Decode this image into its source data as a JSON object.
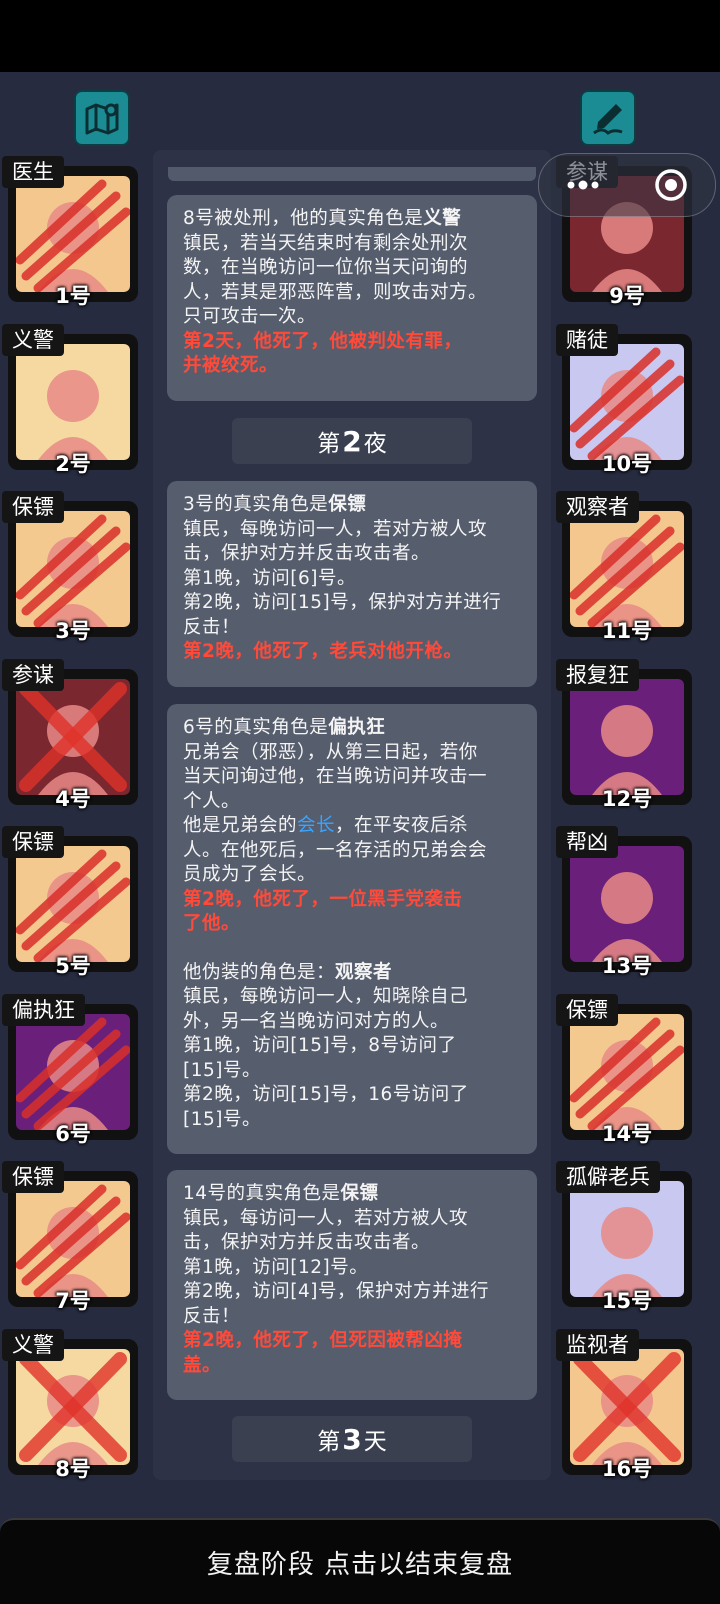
{
  "header": {
    "map_icon": "map-icon",
    "notes_icon": "pen-notepad-icon"
  },
  "left_players": [
    {
      "role": "医生",
      "number": "1号",
      "art_bg": "#f4c78e",
      "status": "claw"
    },
    {
      "role": "义警",
      "number": "2号",
      "art_bg": "#f6d9a0",
      "status": "alive"
    },
    {
      "role": "保镖",
      "number": "3号",
      "art_bg": "#f3c98f",
      "status": "claw"
    },
    {
      "role": "参谋",
      "number": "4号",
      "art_bg": "#7a2730",
      "status": "x"
    },
    {
      "role": "保镖",
      "number": "5号",
      "art_bg": "#f3c98f",
      "status": "claw"
    },
    {
      "role": "偏执狂",
      "number": "6号",
      "art_bg": "#6a1f7a",
      "status": "claw"
    },
    {
      "role": "保镖",
      "number": "7号",
      "art_bg": "#f3c98f",
      "status": "claw"
    },
    {
      "role": "义警",
      "number": "8号",
      "art_bg": "#f6d9a0",
      "status": "x"
    }
  ],
  "right_players": [
    {
      "role": "参谋",
      "number": "9号",
      "art_bg": "#7a2730",
      "status": "alive"
    },
    {
      "role": "赌徒",
      "number": "10号",
      "art_bg": "#c8c8f0",
      "status": "claw"
    },
    {
      "role": "观察者",
      "number": "11号",
      "art_bg": "#f4c78e",
      "status": "claw"
    },
    {
      "role": "报复狂",
      "number": "12号",
      "art_bg": "#6a1f7a",
      "status": "alive"
    },
    {
      "role": "帮凶",
      "number": "13号",
      "art_bg": "#6a1f7a",
      "status": "alive"
    },
    {
      "role": "保镖",
      "number": "14号",
      "art_bg": "#f3c98f",
      "status": "claw"
    },
    {
      "role": "孤僻老兵",
      "number": "15号",
      "art_bg": "#c8c8f0",
      "status": "alive"
    },
    {
      "role": "监视者",
      "number": "16号",
      "art_bg": "#f4c78e",
      "status": "x"
    }
  ],
  "log": {
    "card1": {
      "title_pre": "8号被处刑，他的真实角色是",
      "title_role": "义警",
      "lines": [
        "镇民，若当天结束时有剩余处刑次",
        "数，在当晚访问一位你当天问询的",
        "人，若其是邪恶阵营，则攻击对方。",
        "只可攻击一次。"
      ],
      "red": [
        "第2天，他死了，他被判处有罪，",
        "并被绞死。"
      ]
    },
    "divider1": {
      "pre": "第",
      "num": "2",
      "post": "夜"
    },
    "card2": {
      "title_pre": "3号的真实角色是",
      "title_role": "保镖",
      "lines": [
        "镇民，每晚访问一人，若对方被人攻",
        "击，保护对方并反击攻击者。",
        "第1晚，访问[6]号。",
        "第2晚，访问[15]号，保护对方并进行",
        "反击！"
      ],
      "red": [
        "第2晚，他死了，老兵对他开枪。"
      ]
    },
    "card3": {
      "title_pre": "6号的真实角色是",
      "title_role": "偏执狂",
      "lines": [
        "兄弟会（邪恶），从第三日起，若你",
        "当天问询过他，在当晚访问并攻击一",
        "个人。"
      ],
      "leader_pre": "他是兄弟会的",
      "leader_word": "会长",
      "leader_post": "，在平安夜后杀",
      "lines2": [
        "人。在他死后，一名存活的兄弟会会",
        "员成为了会长。"
      ],
      "red": [
        "第2晚，他死了，一位黑手党袭击",
        "了他。"
      ],
      "disguise_pre": "他伪装的角色是：",
      "disguise_role": "观察者",
      "lines3": [
        "镇民，每晚访问一人，知晓除自己",
        "外，另一名当晚访问对方的人。",
        "第1晚，访问[15]号，8号访问了",
        "[15]号。",
        "第2晚，访问[15]号，16号访问了",
        "[15]号。"
      ]
    },
    "card4": {
      "title_pre": "14号的真实角色是",
      "title_role": "保镖",
      "lines": [
        "镇民，每访问一人，若对方被人攻",
        "击，保护对方并反击攻击者。",
        "第1晚，访问[12]号。",
        "第2晚，访问[4]号，保护对方并进行",
        "反击！"
      ],
      "red": [
        "第2晚，他死了，但死因被帮凶掩",
        "盖。"
      ]
    },
    "divider2": {
      "pre": "第",
      "num": "3",
      "post": "天"
    }
  },
  "footer": {
    "label": "复盘阶段 点击以结束复盘"
  },
  "colors": {
    "background": "#262b3f",
    "card": "#565d6d",
    "death_text": "#ff4a3a",
    "leader_text": "#3aa4ff",
    "icon_teal": "#1c8c94"
  }
}
